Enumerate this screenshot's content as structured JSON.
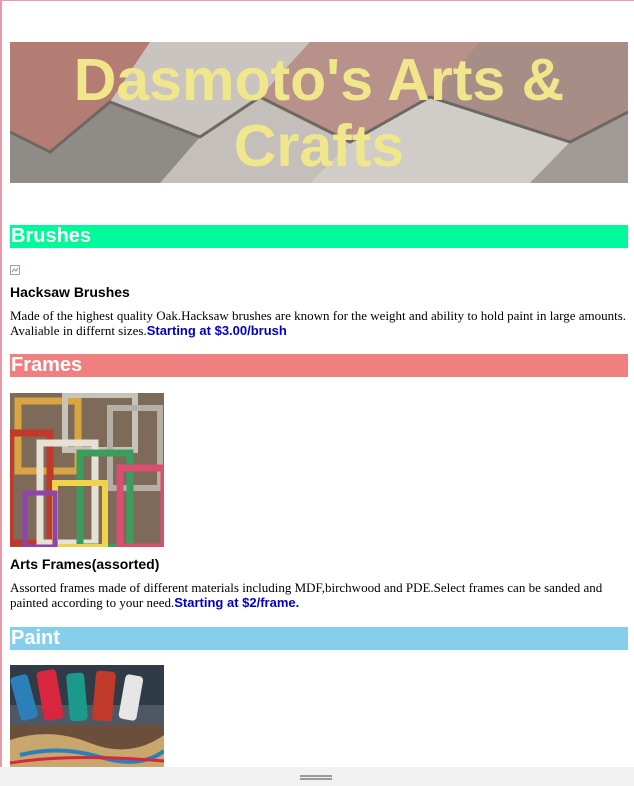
{
  "header": {
    "title": "Dasmoto's Arts & Crafts"
  },
  "sections": {
    "brushes": {
      "heading": "Brushes",
      "product_name": "Hacksaw Brushes",
      "description": "Made of the highest quality Oak.Hacksaw brushes are known for the weight and ability to hold paint in large amounts. Avaliable in differnt sizes.",
      "price": "Starting at $3.00/brush"
    },
    "frames": {
      "heading": "Frames",
      "product_name": "Arts Frames(assorted)",
      "description": "Assorted frames made of different materials including MDF,birchwood and PDE.Select frames can be sanded and painted according to your need.",
      "price": "Starting at $2/frame."
    },
    "paint": {
      "heading": "Paint"
    }
  },
  "colors": {
    "title": "#f0e68c",
    "brushes_bg": "#00fa9a",
    "frames_bg": "#f08080",
    "paint_bg": "#87ceeb",
    "price": "#0000cd"
  },
  "icons": {
    "broken_image": "broken-image-icon",
    "scroll_grip": "drag-handle-icon"
  }
}
